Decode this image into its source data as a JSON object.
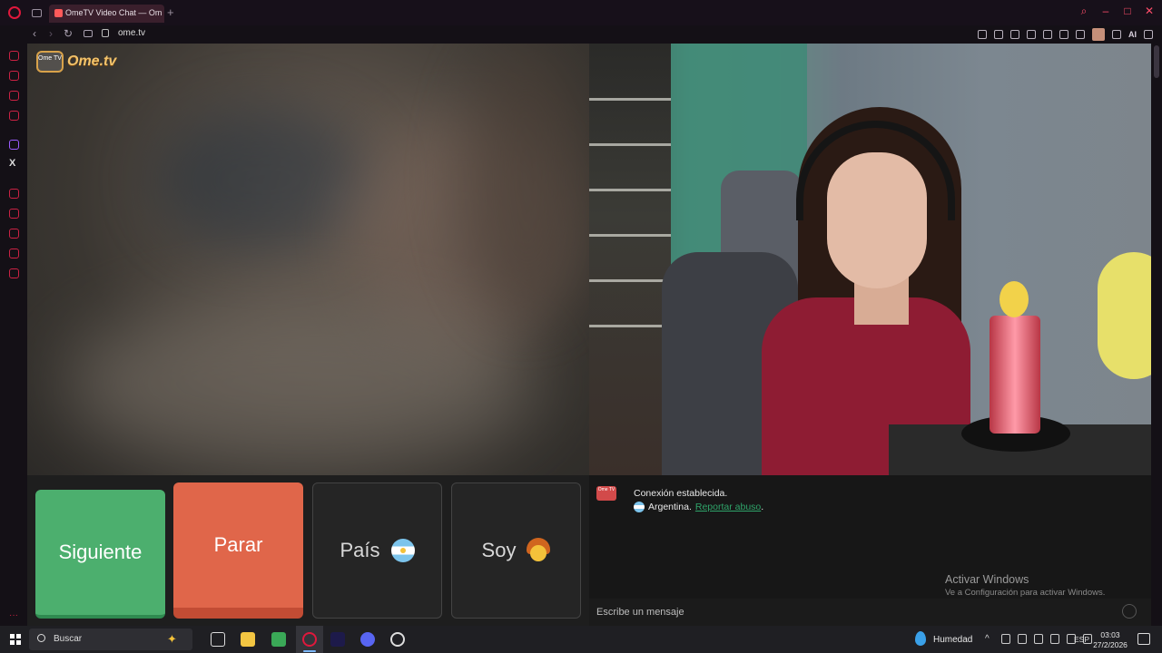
{
  "browser": {
    "tab_title": "OmeTV Video Chat — Omegle",
    "url": "ome.tv",
    "ai_label": "AI",
    "new_tab": "+"
  },
  "site": {
    "logo_text": "Ome.tv",
    "logo_badge": "Ome TV"
  },
  "controls": {
    "next_label": "Siguiente",
    "stop_label": "Parar",
    "country_label": "País",
    "country_flag": "argentina-flag-icon",
    "gender_label": "Soy",
    "gender_icon": "boy-emoji-icon",
    "next_color": "#4caf6e",
    "stop_color": "#e0664a"
  },
  "chat": {
    "status": "Conexión establecida.",
    "country": "Argentina.",
    "report_link": "Reportar abuso",
    "report_suffix": ".",
    "input_placeholder": "Escribe un mensaje",
    "link_color": "#2fa46a"
  },
  "watermark": {
    "title": "Activar Windows",
    "subtitle": "Ve a Configuración para activar Windows."
  },
  "taskbar": {
    "search_placeholder": "Buscar",
    "weather": "Humedad",
    "language": "ESP",
    "time": "03:03",
    "date": "27/2/2026"
  }
}
